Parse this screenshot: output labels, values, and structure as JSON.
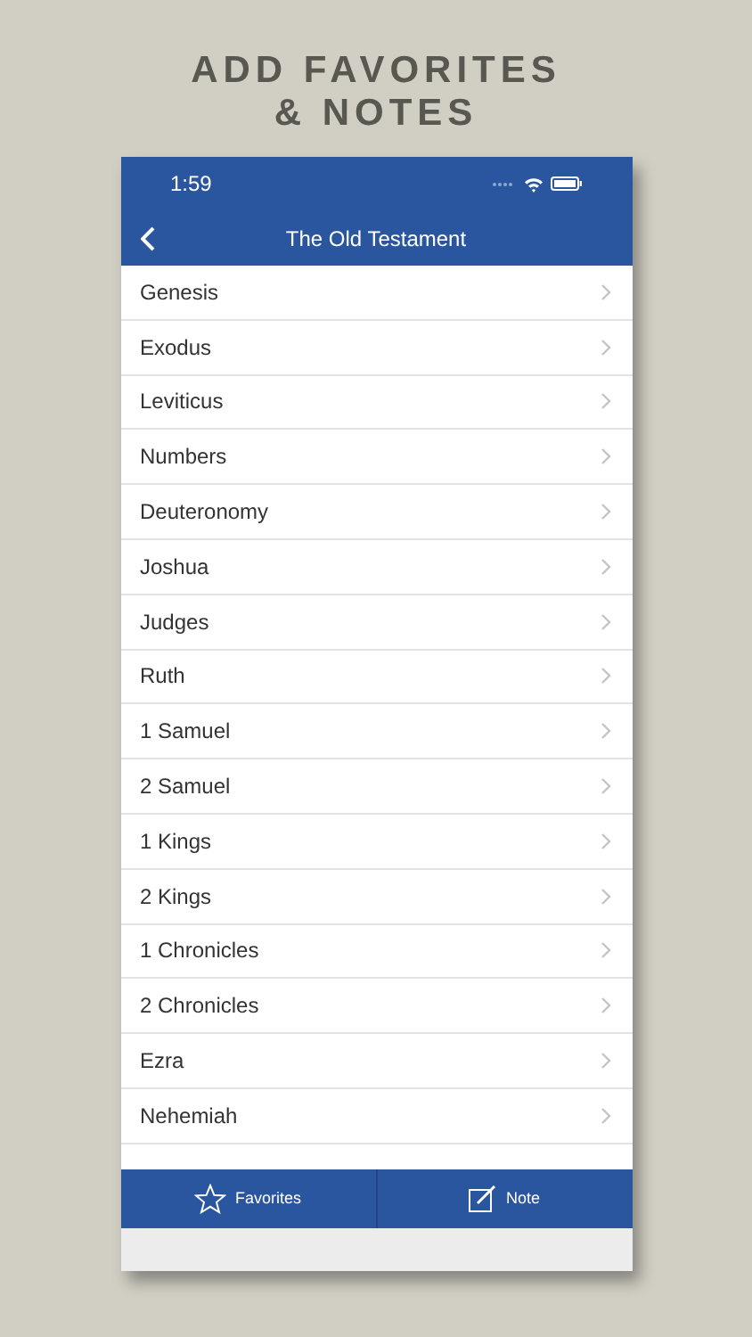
{
  "headline": [
    "ADD FAVORITES",
    "& NOTES"
  ],
  "status_bar": {
    "time": "1:59"
  },
  "nav_bar": {
    "title": "The Old Testament"
  },
  "books": [
    "Genesis",
    "Exodus",
    "Leviticus",
    "Numbers",
    "Deuteronomy",
    "Joshua",
    "Judges",
    "Ruth",
    "1 Samuel",
    "2 Samuel",
    "1 Kings",
    "2 Kings",
    "1 Chronicles",
    "2 Chronicles",
    "Ezra",
    "Nehemiah"
  ],
  "tab_bar": [
    {
      "kind": "favorites",
      "label": "Favorites"
    },
    {
      "kind": "note",
      "label": "Note"
    }
  ]
}
